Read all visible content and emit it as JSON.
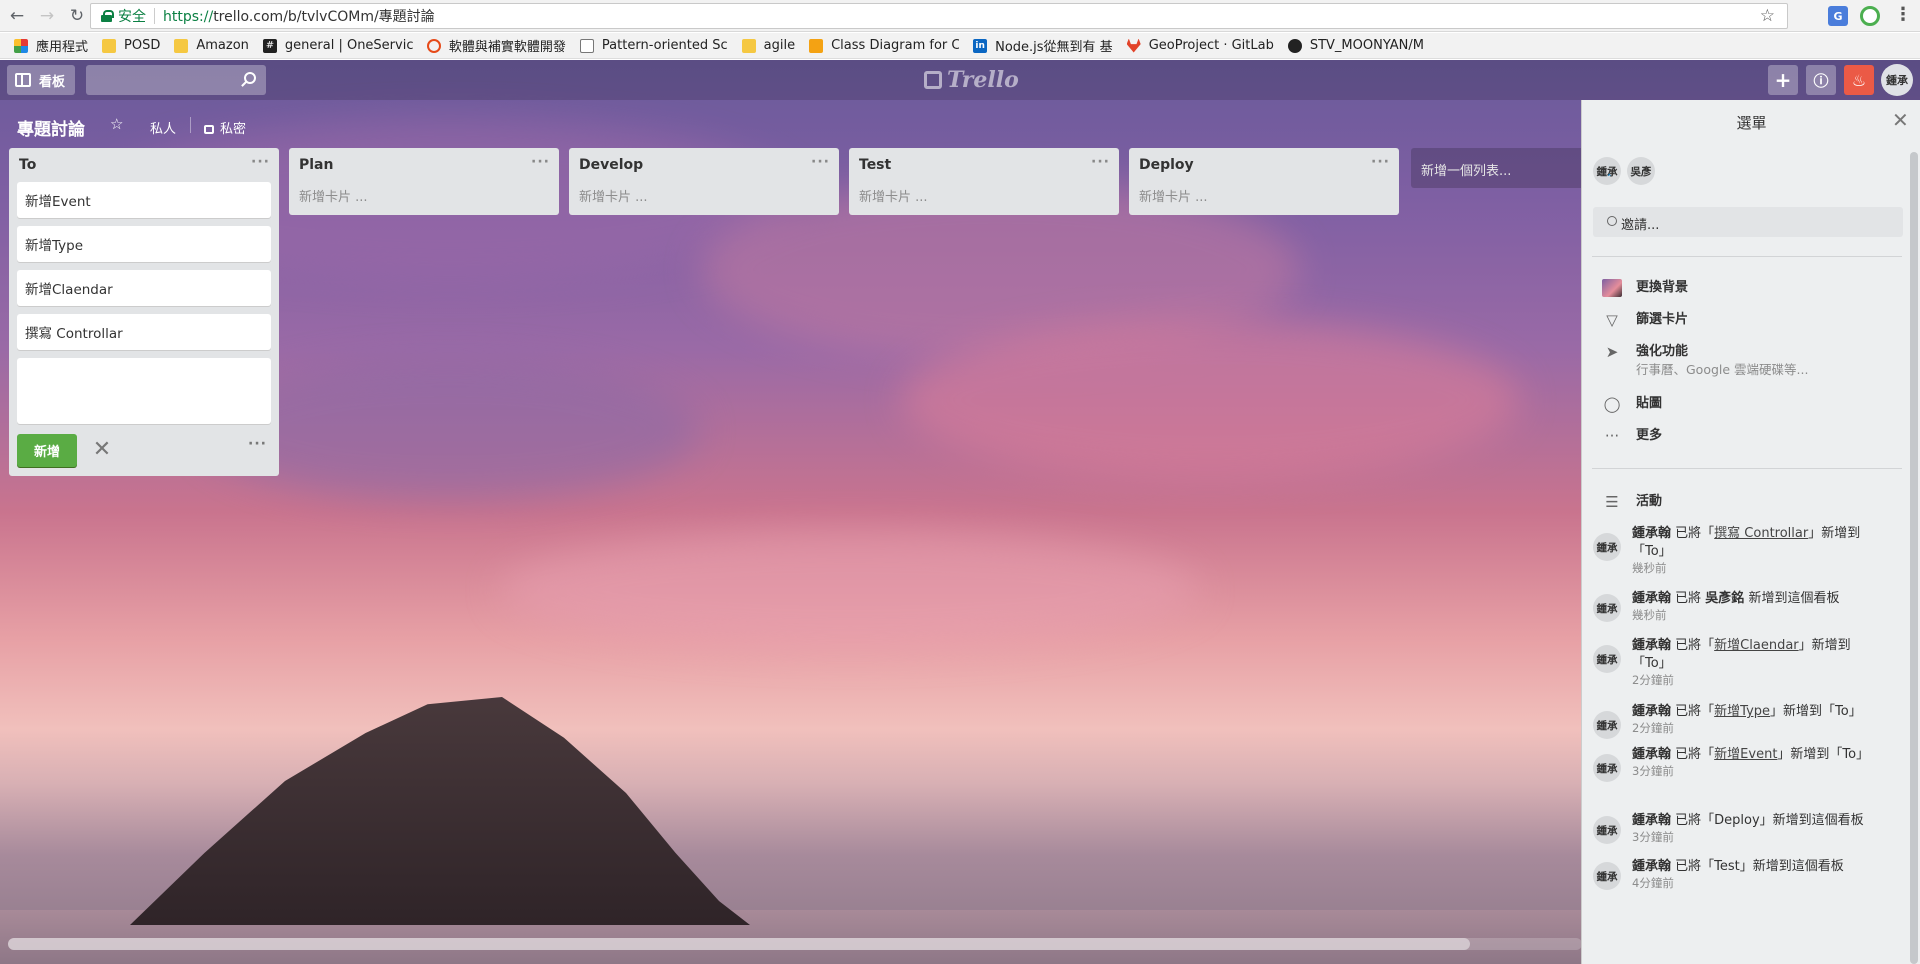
{
  "browser": {
    "secure_label": "安全",
    "url_scheme": "https://",
    "url_rest": "trello.com/b/tvlvCOMm/專題討論",
    "bookmarks": [
      {
        "label": "應用程式",
        "icon": "apps-grid-icon"
      },
      {
        "label": "POSD",
        "icon": "folder-icon"
      },
      {
        "label": "Amazon",
        "icon": "folder-icon"
      },
      {
        "label": "general | OneServic",
        "icon": "slack-icon"
      },
      {
        "label": "軟體與補實軟體開發",
        "icon": "red-circle-icon"
      },
      {
        "label": "Pattern-oriented Sc",
        "icon": "document-icon"
      },
      {
        "label": "agile",
        "icon": "folder-icon"
      },
      {
        "label": "Class Diagram for C",
        "icon": "orange-app-icon"
      },
      {
        "label": "Node.js從無到有 基",
        "icon": "linkedin-icon"
      },
      {
        "label": "GeoProject · GitLab",
        "icon": "gitlab-icon"
      },
      {
        "label": "STV_MOONYAN/M",
        "icon": "github-icon"
      }
    ]
  },
  "header": {
    "boards_label": "看板",
    "logo_text": "Trello",
    "user_initials": "鍾承"
  },
  "board": {
    "title": "專題討論",
    "visibility_private": "私人",
    "visibility_secret": "私密"
  },
  "lists": [
    {
      "title": "To",
      "cards": [
        "新增Event",
        "新增Type",
        "新增Claendar",
        "撰寫 Controllar"
      ],
      "add_button": "新增"
    },
    {
      "title": "Plan",
      "add_card": "新增卡片 ..."
    },
    {
      "title": "Develop",
      "add_card": "新增卡片 ..."
    },
    {
      "title": "Test",
      "add_card": "新增卡片 ..."
    },
    {
      "title": "Deploy",
      "add_card": "新增卡片 ..."
    }
  ],
  "add_list_label": "新增一個列表...",
  "sidebar": {
    "title": "選單",
    "members": [
      "鍾承",
      "吳彥"
    ],
    "invite_label": "邀請...",
    "menu": [
      {
        "label": "更換背景",
        "icon": "background-thumbnail-icon"
      },
      {
        "label": "篩選卡片",
        "icon": "filter-icon"
      },
      {
        "label": "強化功能",
        "sub": "行事曆、Google 雲端硬碟等...",
        "icon": "rocket-icon"
      },
      {
        "label": "貼圖",
        "icon": "sticker-icon"
      },
      {
        "label": "更多",
        "icon": "more-dots-icon"
      }
    ],
    "activity_label": "活動",
    "activity": [
      {
        "user": "鍾承翰",
        "pre": "已將「",
        "link": "撰寫 Controllar",
        "post": "」新增到「To」",
        "time": "幾秒前"
      },
      {
        "user": "鍾承翰",
        "pre": "已將 ",
        "bold_target": "吳彥銘",
        "post": " 新增到這個看板",
        "time": "幾秒前"
      },
      {
        "user": "鍾承翰",
        "pre": "已將「",
        "link": "新增Claendar",
        "post": "」新增到「To」",
        "time": "2分鐘前"
      },
      {
        "user": "鍾承翰",
        "pre": "已將「",
        "link": "新增Type",
        "post": "」新增到「To」",
        "time": "2分鐘前"
      },
      {
        "user": "鍾承翰",
        "pre": "已將「",
        "link": "新增Event",
        "post": "」新增到「To」",
        "time": "3分鐘前"
      },
      {
        "user": "鍾承翰",
        "pre": "已將「Deploy」新增到這個看板",
        "post": "",
        "time": "3分鐘前"
      },
      {
        "user": "鍾承翰",
        "pre": "已將「Test」新增到這個看板",
        "post": "",
        "time": "4分鐘前"
      }
    ],
    "activity_avatar": "鍾承"
  }
}
